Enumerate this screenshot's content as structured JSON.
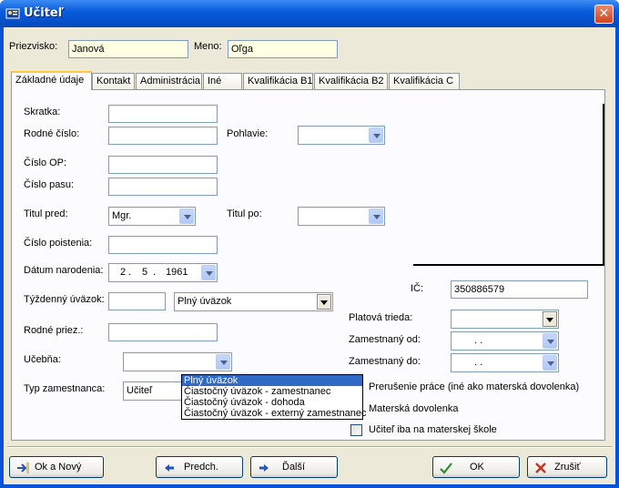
{
  "window": {
    "title": "Učiteľ",
    "close_label": "✕"
  },
  "header": {
    "surname_label": "Priezvisko:",
    "surname_value": "Janová",
    "firstname_label": "Meno:",
    "firstname_value": "Oľga"
  },
  "tabs": [
    "Základné údaje",
    "Kontakt",
    "Administrácia",
    "Iné",
    "Kvalifikácia B1",
    "Kvalifikácia B2",
    "Kvalifikácia C"
  ],
  "form": {
    "abbrev_label": "Skratka:",
    "abbrev_value": "",
    "birth_no_label": "Rodné číslo:",
    "birth_no_value": "",
    "gender_label": "Pohlavie:",
    "gender_value": "",
    "id_card_label": "Číslo OP:",
    "id_card_value": "",
    "passport_label": "Číslo pasu:",
    "passport_value": "",
    "title_before_label": "Titul pred:",
    "title_before_value": "Mgr.",
    "title_after_label": "Titul po:",
    "title_after_value": "",
    "insurance_label": "Číslo poistenia:",
    "insurance_value": "",
    "dob_label": "Dátum narodenia:",
    "dob_day": "2",
    "dob_month": "5",
    "dob_year": "1961",
    "workload_label": "Týždenný úväzok:",
    "workload_value": "",
    "workload_type_value": "Plný úväzok",
    "maiden_label": "Rodné priez.:",
    "classroom_label": "Učebňa:",
    "emp_type_label": "Typ zamestnanca:",
    "emp_type_value": "Učiteľ",
    "ico_label": "IČ:",
    "ico_value": "350886579",
    "pay_class_label": "Platová trieda:",
    "emp_from_label": "Zamestnaný od:",
    "emp_from_value": ". .",
    "emp_to_label": "Zamestnaný do:",
    "emp_to_value": ". .",
    "chk_interruption": "Prerušenie práce (iné ako materská dovolenka)",
    "chk_maternity": "Materská dovolenka",
    "chk_kindergarten": "Učiteľ iba na materskej škole"
  },
  "workload_options": [
    "Plný úväzok",
    "Čiastočný úväzok - zamestnanec",
    "Čiastočný úväzok - dohoda",
    "Čiastočný úväzok - externý zamestnanec"
  ],
  "buttons": {
    "ok_new": "Ok a Nový",
    "prev": "Predch.",
    "next": "Ďalší",
    "ok": "OK",
    "cancel": "Zrušiť"
  }
}
